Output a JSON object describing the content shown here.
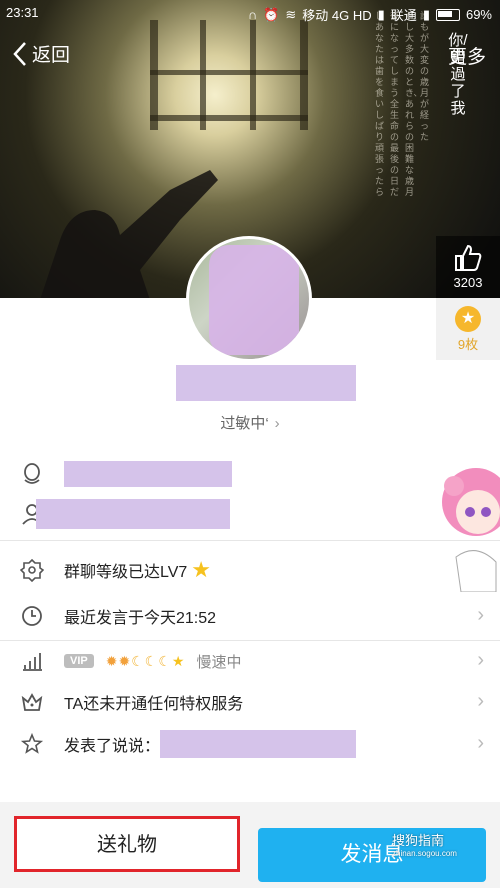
{
  "status_bar": {
    "time": "23:31",
    "carrier1": "移动 4G HD",
    "carrier2": "联通",
    "battery": "69%"
  },
  "nav": {
    "back_label": "返回",
    "more_label": "更多"
  },
  "cover": {
    "vertical_text": "你/錯過了我",
    "poem_lines": [
      "誰もが大変の歳月が経った",
      "かし大多数のとき、あれらの困難な歳月",
      "後になってしまう全生命の最後の日だ",
      "しあなたは歯を食いしばり頑張ったら"
    ]
  },
  "side_panel": {
    "like_count": "3203",
    "medal_count": "9枚"
  },
  "profile": {
    "status_text": "过敏中‘"
  },
  "info_rows": {
    "group_level": "群聊等级已达LV7",
    "last_speak": "最近发言于今天21:52",
    "vip_label": "VIP",
    "speed_text": "慢速中",
    "privilege_text": "TA还未开通任何特权服务",
    "posted_label": "发表了说说："
  },
  "actions": {
    "gift_label": "送礼物",
    "message_label": "发消息"
  },
  "watermark": {
    "title": "搜狗指南",
    "url": "zhinan.sogou.com"
  }
}
